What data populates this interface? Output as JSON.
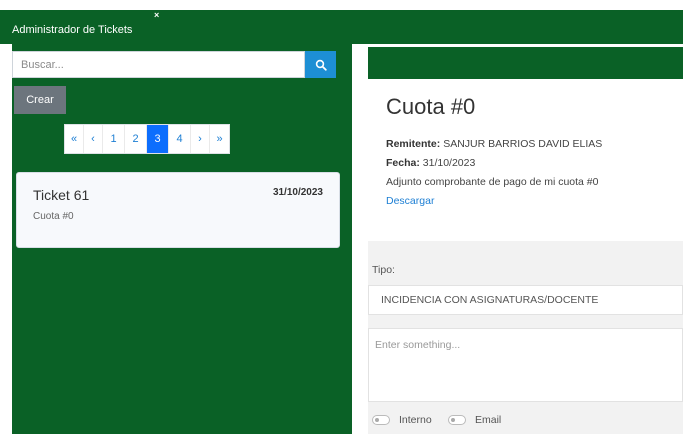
{
  "window": {
    "title": "Administrador de Tickets",
    "close_glyph": "×"
  },
  "sidebar": {
    "search_placeholder": "Buscar...",
    "search_icon": "search-icon",
    "create_label": "Crear",
    "pagination": [
      "«",
      "‹",
      "1",
      "2",
      "3",
      "4",
      "›",
      "»"
    ],
    "active_page": "3",
    "tickets": [
      {
        "title": "Ticket 61",
        "date": "31/10/2023",
        "subject": "Cuota #0"
      }
    ]
  },
  "detail": {
    "title": "Cuota #0",
    "sender_label": "Remitente:",
    "sender": "SANJUR BARRIOS DAVID ELIAS",
    "date_label": "Fecha:",
    "date": "31/10/2023",
    "message": "Adjunto comprobante de pago de mi cuota #0",
    "download_label": "Descargar"
  },
  "form": {
    "type_label": "Tipo:",
    "type_value": "INCIDENCIA CON ASIGNATURAS/DOCENTE",
    "text_placeholder": "Enter something...",
    "internal_label": "Interno",
    "email_label": "Email"
  },
  "colors": {
    "primary_green": "#0a6126",
    "accent_blue": "#1d8fd4",
    "active_page_blue": "#0d6efd",
    "button_gray": "#6c757d"
  }
}
